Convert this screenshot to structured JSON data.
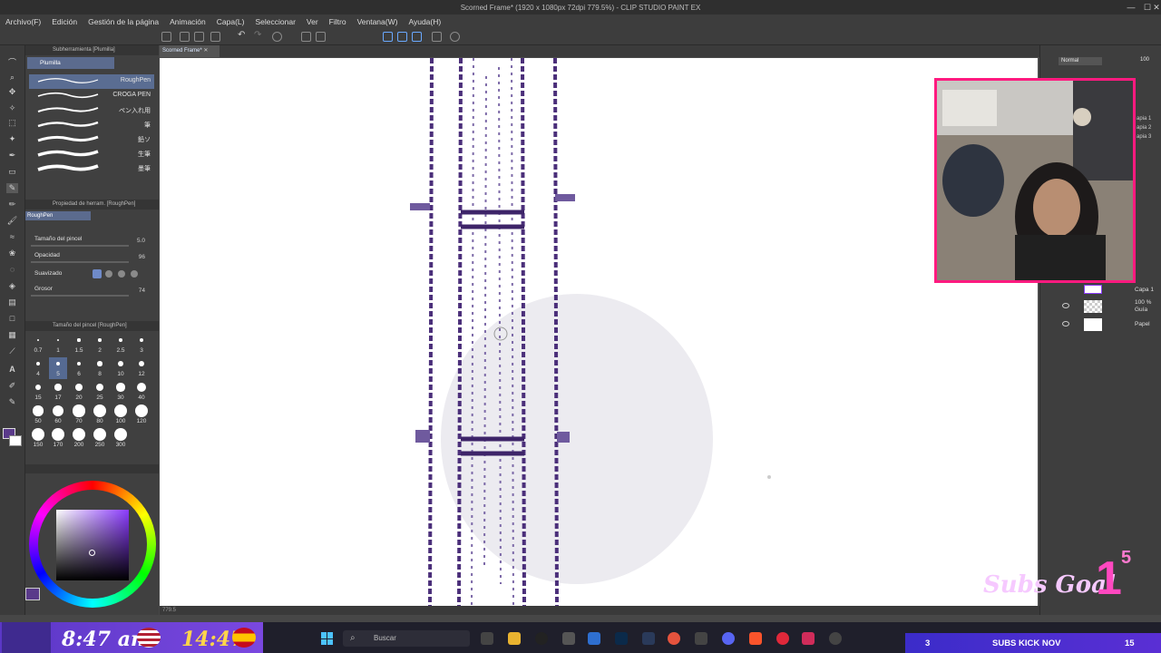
{
  "window": {
    "title": "Scorned Frame* (1920 x 1080px 72dpi 779.5%) - CLIP STUDIO PAINT EX"
  },
  "menu": [
    "Archivo(F)",
    "Edición",
    "Gestión de la página",
    "Animación",
    "Capa(L)",
    "Seleccionar",
    "Ver",
    "Filtro",
    "Ventana(W)",
    "Ayuda(H)"
  ],
  "canvas_tab": "Scorned Frame*",
  "canvas_status": "779.5",
  "subtool": {
    "header": "Subherramienta [Plumilla]",
    "group": "Plumilla",
    "brushes": [
      "RoughPen",
      "CROGA PEN",
      "ペン入れ用",
      "筆",
      "鉛ソ",
      "生筆",
      "墨筆"
    ]
  },
  "tool_property": {
    "header": "Propiedad de herram. [RoughPen]",
    "current": "RoughPen",
    "rows": [
      {
        "label": "Tamaño del pincel",
        "value": "5.0"
      },
      {
        "label": "Opacidad",
        "value": "96"
      },
      {
        "label": "Suavizado",
        "value": ""
      },
      {
        "label": "Grosor",
        "value": "74"
      }
    ]
  },
  "brush_size": {
    "header": "Tamaño del pincel [RoughPen]",
    "sizes": [
      "0.7",
      "1",
      "1.5",
      "2",
      "2.5",
      "3",
      "4",
      "5",
      "6",
      "8",
      "10",
      "12",
      "15",
      "17",
      "20",
      "25",
      "30",
      "40",
      "50",
      "60",
      "70",
      "80",
      "100",
      "120",
      "150",
      "170",
      "200",
      "250",
      "300"
    ],
    "selected": "5"
  },
  "color": {
    "current": "#5a3a8a",
    "wheel_selection": "#000000"
  },
  "layers": {
    "blend_mode": "Normal",
    "opacity": "100",
    "items": [
      {
        "name": "Capa 1"
      },
      {
        "name": "Guía",
        "opacity": "100 %"
      },
      {
        "name": "Papel"
      }
    ],
    "side_labels": [
      "apia 1",
      "apia 2",
      "apia 3"
    ]
  },
  "taskbar": {
    "time_left": "8:47 am",
    "time_right": "14:47",
    "search_label": "Buscar",
    "subs_count": "3",
    "subs_label": "SUBS KICK NOV",
    "subs_goal_target": "15",
    "subs_goal_text": "Subs Goal",
    "subs_goal_number": "1",
    "subs_goal_super": "5"
  }
}
